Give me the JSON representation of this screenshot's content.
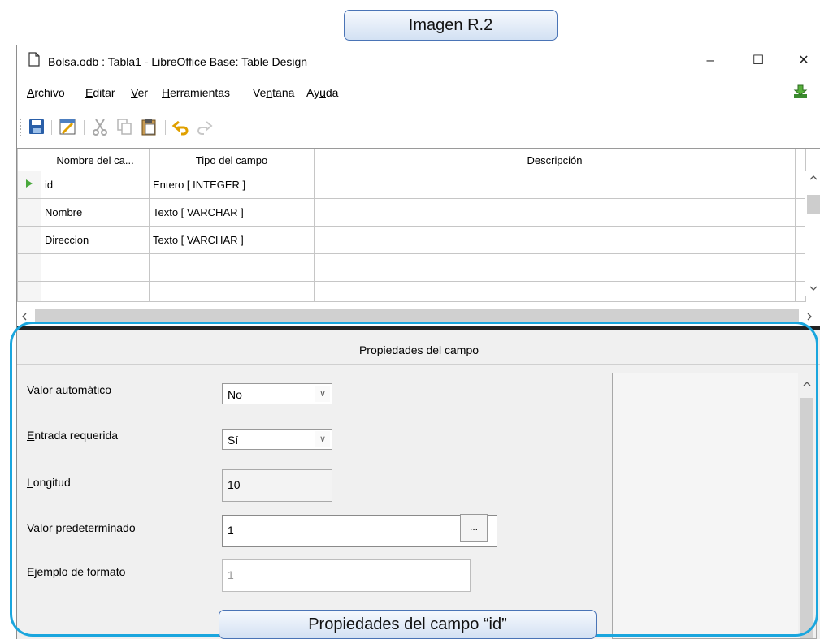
{
  "callouts": {
    "top": "Imagen R.2",
    "bottom": "Propiedades del campo “id”"
  },
  "window": {
    "title": "Bolsa.odb : Tabla1 - LibreOffice Base: Table Design",
    "minimize": "–",
    "maximize": "☐",
    "close": "✕"
  },
  "menu": {
    "archivo": {
      "pre": "",
      "key": "A",
      "post": "rchivo"
    },
    "editar": {
      "pre": "",
      "key": "E",
      "post": "ditar"
    },
    "ver": {
      "pre": "",
      "key": "V",
      "post": "er"
    },
    "herramientas": {
      "pre": "",
      "key": "H",
      "post": "erramientas"
    },
    "ventana": {
      "pre": "Ve",
      "key": "n",
      "post": "tana"
    },
    "ayuda": {
      "pre": "Ay",
      "key": "u",
      "post": "da"
    }
  },
  "grid": {
    "headers": [
      "Nombre del ca...",
      "Tipo del campo",
      "Descripción"
    ],
    "rows": [
      {
        "name": "id",
        "type": "Entero [ INTEGER ]",
        "desc": ""
      },
      {
        "name": "Nombre",
        "type": "Texto [ VARCHAR ]",
        "desc": ""
      },
      {
        "name": "Direccion",
        "type": "Texto [ VARCHAR ]",
        "desc": ""
      },
      {
        "name": "",
        "type": "",
        "desc": ""
      },
      {
        "name": "",
        "type": "",
        "desc": ""
      }
    ]
  },
  "properties": {
    "header": "Propiedades del campo",
    "auto_value": {
      "pre": "",
      "key": "V",
      "post": "alor automático",
      "value": "No"
    },
    "required": {
      "pre": "",
      "key": "E",
      "post": "ntrada requerida",
      "value": "Sí"
    },
    "length": {
      "pre": "",
      "key": "L",
      "post": "ongitud",
      "value": "10"
    },
    "default_value": {
      "pre": "Valor pre",
      "key": "d",
      "post": "eterminado",
      "value": "1"
    },
    "format_example": {
      "label": "Ejemplo de formato",
      "value": "1",
      "button": "..."
    }
  },
  "colors": {
    "accent_ring": "#1aa6de",
    "callout_border": "#4a74b6"
  }
}
